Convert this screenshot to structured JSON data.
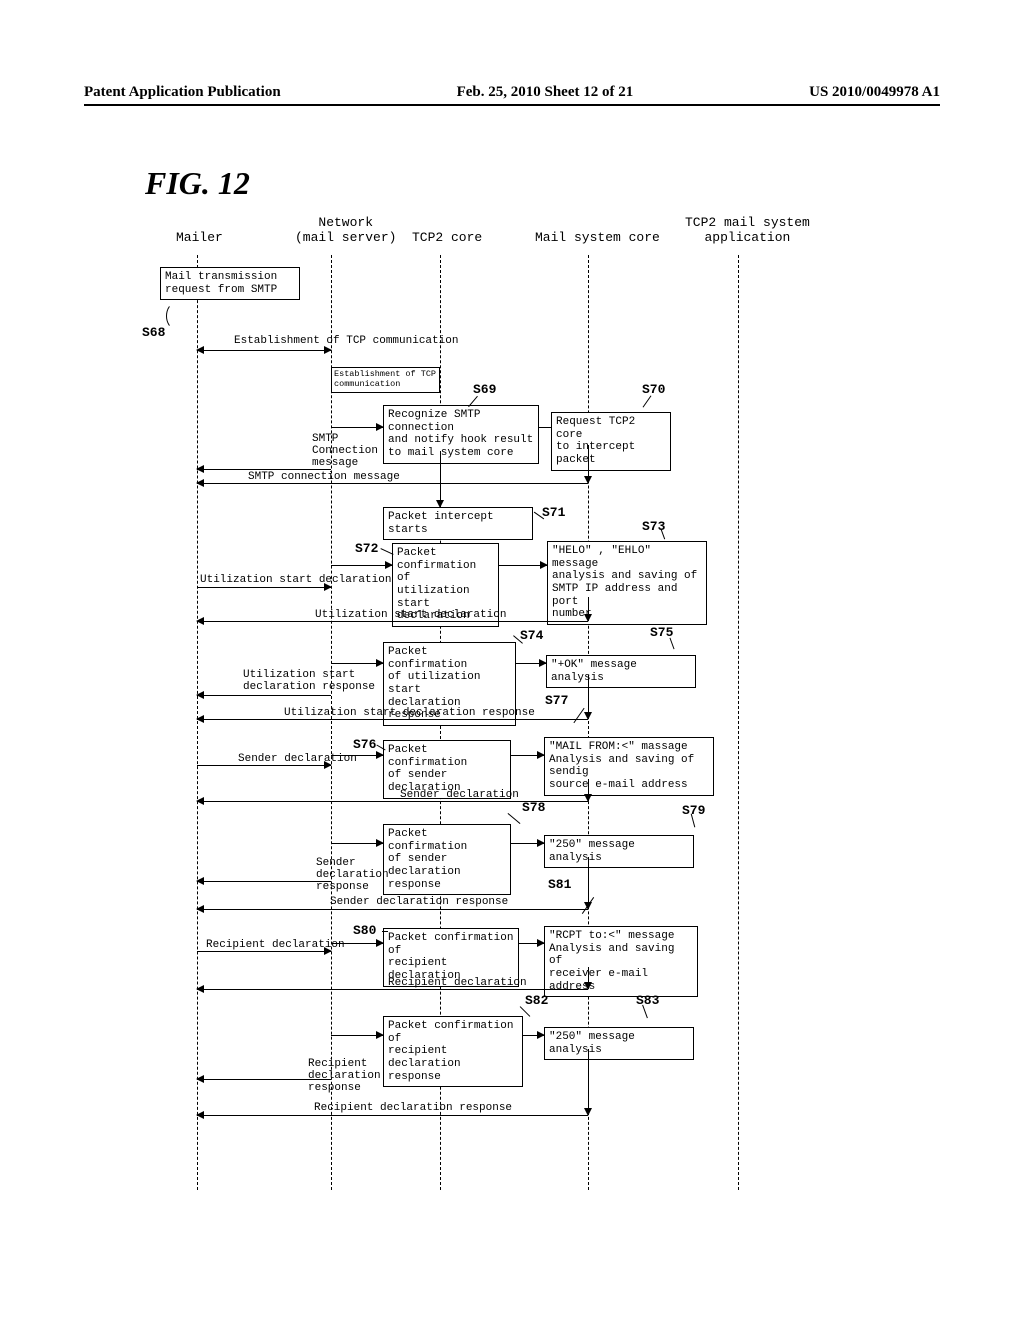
{
  "header": {
    "left": "Patent Application Publication",
    "center": "Feb. 25, 2010  Sheet 12 of 21",
    "right": "US 2010/0049978 A1"
  },
  "figure_label": "FIG. 12",
  "lanes": {
    "mailer": "Mailer",
    "network": "Network\n(mail server)",
    "tcp2core": "TCP2 core",
    "mailsyscore": "Mail system core",
    "app": "TCP2 mail system\napplication"
  },
  "steps": {
    "s68": "S68",
    "s69": "S69",
    "s70": "S70",
    "s71": "S71",
    "s72": "S72",
    "s73": "S73",
    "s74": "S74",
    "s75": "S75",
    "s76": "S76",
    "s77": "S77",
    "s78": "S78",
    "s79": "S79",
    "s80": "S80",
    "s81": "S81",
    "s82": "S82",
    "s83": "S83"
  },
  "boxes": {
    "b68": "Mail transmission\nrequest from SMTP",
    "b_establish_inner": "Establishment of TCP communication",
    "b69": "Recognize SMTP connection\nand notify hook result\nto mail system core",
    "b70": "Request TCP2 core\nto intercept packet",
    "b71": "Packet intercept starts",
    "b72": "Packet\nconfirmation of\nutilization start\ndeclaration",
    "b73": "\"HELO\" , \"EHLO\" message\nanalysis and saving of\nSMTP IP address and port\nnumber",
    "b74": "Packet confirmation\nof utilization start\ndeclaration response",
    "b75": "\"+OK\"  message analysis",
    "b76": "Packet confirmation\nof sender declaration",
    "b77": "\"MAIL FROM:<\" massage\nAnalysis and saving of sendig\nsource e-mail address",
    "b78": "Packet confirmation\nof sender declaration\nresponse",
    "b79": "\"250\"  message analysis",
    "b80": "Packet confirmation of\nrecipient declaration",
    "b81": "\"RCPT to:<\"    message\nAnalysis and saving of\nreceiver e-mail address",
    "b82": "Packet confirmation of\nrecipient declaration\nresponse",
    "b83": "\"250\"  message analysis"
  },
  "messages": {
    "m_estab_tcp": "Establishment of TCP communication",
    "m_smtp_conn": "SMTP\nConnection\nmessage",
    "m_smtp_conn2": "SMTP connection message",
    "m_util_start": "Utilization start declaration",
    "m_util_start2": "Utilization start declaration",
    "m_util_start_resp": "Utilization start\ndeclaration response",
    "m_util_start_resp2": "Utilization start declaration response",
    "m_sender_decl": "Sender declaration",
    "m_sender_decl2": "Sender declaration",
    "m_sender_resp": "Sender\ndeclaration\nresponse",
    "m_sender_resp2": "Sender declaration response",
    "m_recip_decl": "Recipient declaration",
    "m_recip_decl2": "Recipient declaration",
    "m_recip_resp": "Recipient\ndeclaration\nresponse",
    "m_recip_resp2": "Recipient declaration response"
  }
}
